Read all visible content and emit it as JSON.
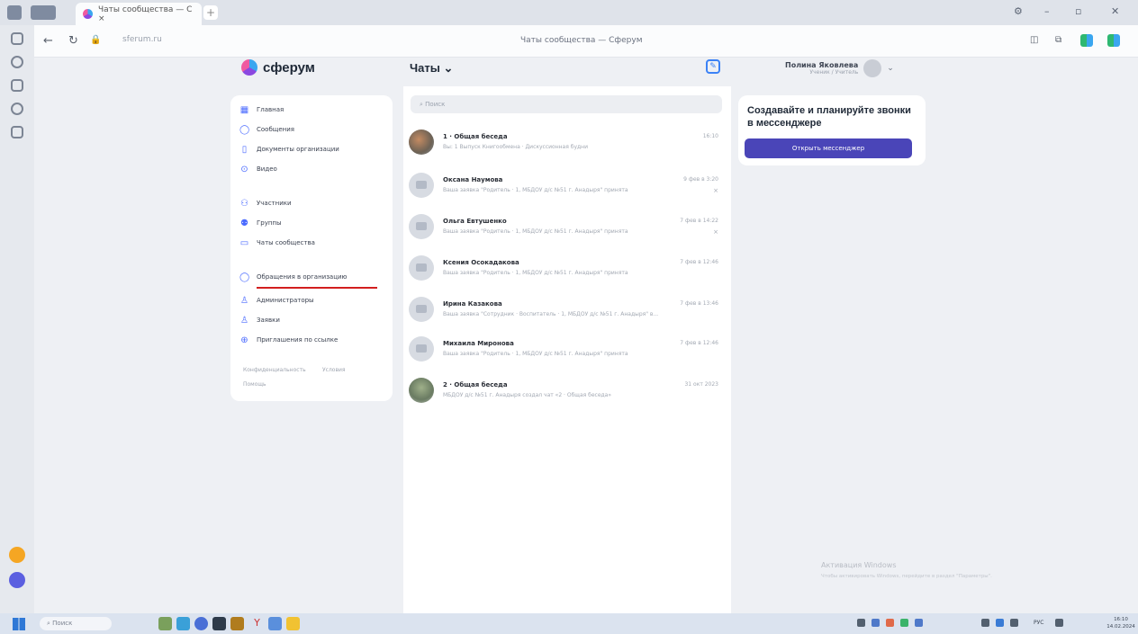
{
  "browser": {
    "tab_title": "Чаты сообщества — С ×",
    "new_tab": "+",
    "url": "sferum.ru",
    "page_title": "Чаты сообщества — Сферум",
    "window_controls": {
      "minimize": "–",
      "maximize": "▫",
      "close": "✕"
    }
  },
  "header": {
    "logo": "сферум",
    "chats_title": "Чаты ⌄",
    "user_name": "Полина Яковлева",
    "user_sub": "Ученик / Учитель"
  },
  "sidebar": {
    "items": [
      {
        "label": "Главная",
        "icon": "grid-icon"
      },
      {
        "label": "Сообщения",
        "icon": "chat-icon"
      },
      {
        "label": "Документы организации",
        "icon": "document-icon"
      },
      {
        "label": "Видео",
        "icon": "play-icon"
      },
      {
        "label": "Участники",
        "icon": "users-icon"
      },
      {
        "label": "Группы",
        "icon": "groups-icon"
      },
      {
        "label": "Чаты сообщества",
        "icon": "chats-icon"
      },
      {
        "label": "Обращения в организацию",
        "icon": "chat-icon"
      },
      {
        "label": "Администраторы",
        "icon": "admin-icon"
      },
      {
        "label": "Заявки",
        "icon": "add-user-icon"
      },
      {
        "label": "Приглашения по ссылке",
        "icon": "link-icon"
      }
    ],
    "footer_links": [
      "Конфиденциальность",
      "Условия",
      "Помощь"
    ]
  },
  "chats": {
    "search_placeholder": "Поиск",
    "items": [
      {
        "name": "1 · Общая беседа",
        "preview": "Вы: 1 Выпуск Книгообмена · Дискуссионная будни",
        "time": "16:10",
        "muted": ""
      },
      {
        "name": "Оксана Наумова",
        "preview": "Ваша заявка \"Родитель · 1, МБДОУ д/с №51 г. Анадыря\" принята",
        "time": "9 фев в 3:20",
        "muted": "×"
      },
      {
        "name": "Ольга Евтушенко",
        "preview": "Ваша заявка \"Родитель · 1, МБДОУ д/с №51 г. Анадыря\" принята",
        "time": "7 фев в 14:22",
        "muted": "×"
      },
      {
        "name": "Ксения Осокадакова",
        "preview": "Ваша заявка \"Родитель · 1, МБДОУ д/с №51 г. Анадыря\" принята",
        "time": "7 фев в 12:46",
        "muted": ""
      },
      {
        "name": "Ирина Казакова",
        "preview": "Ваша заявка \"Сотрудник · Воспитатель · 1, МБДОУ д/с №51 г. Анадыря\" в...",
        "time": "7 фев в 13:46",
        "muted": ""
      },
      {
        "name": "Михаила Миронова",
        "preview": "Ваша заявка \"Родитель · 1, МБДОУ д/с №51 г. Анадыря\" принята",
        "time": "7 фев в 12:46",
        "muted": ""
      },
      {
        "name": "2 · Общая беседа",
        "preview": "МБДОУ д/с №51 г. Анадыря создал чат «2 · Общая беседа»",
        "time": "31 окт 2023",
        "muted": ""
      }
    ]
  },
  "call_card": {
    "title": "Создавайте и планируйте звонки в мессенджере",
    "button": "Открыть мессенджер"
  },
  "watermark": {
    "title": "Активация Windows",
    "subtitle": "Чтобы активировать Windows, перейдите в раздел \"Параметры\"."
  },
  "taskbar": {
    "search": "Поиск",
    "lang": "РУС",
    "clock": "16:10 14.02.2024"
  }
}
